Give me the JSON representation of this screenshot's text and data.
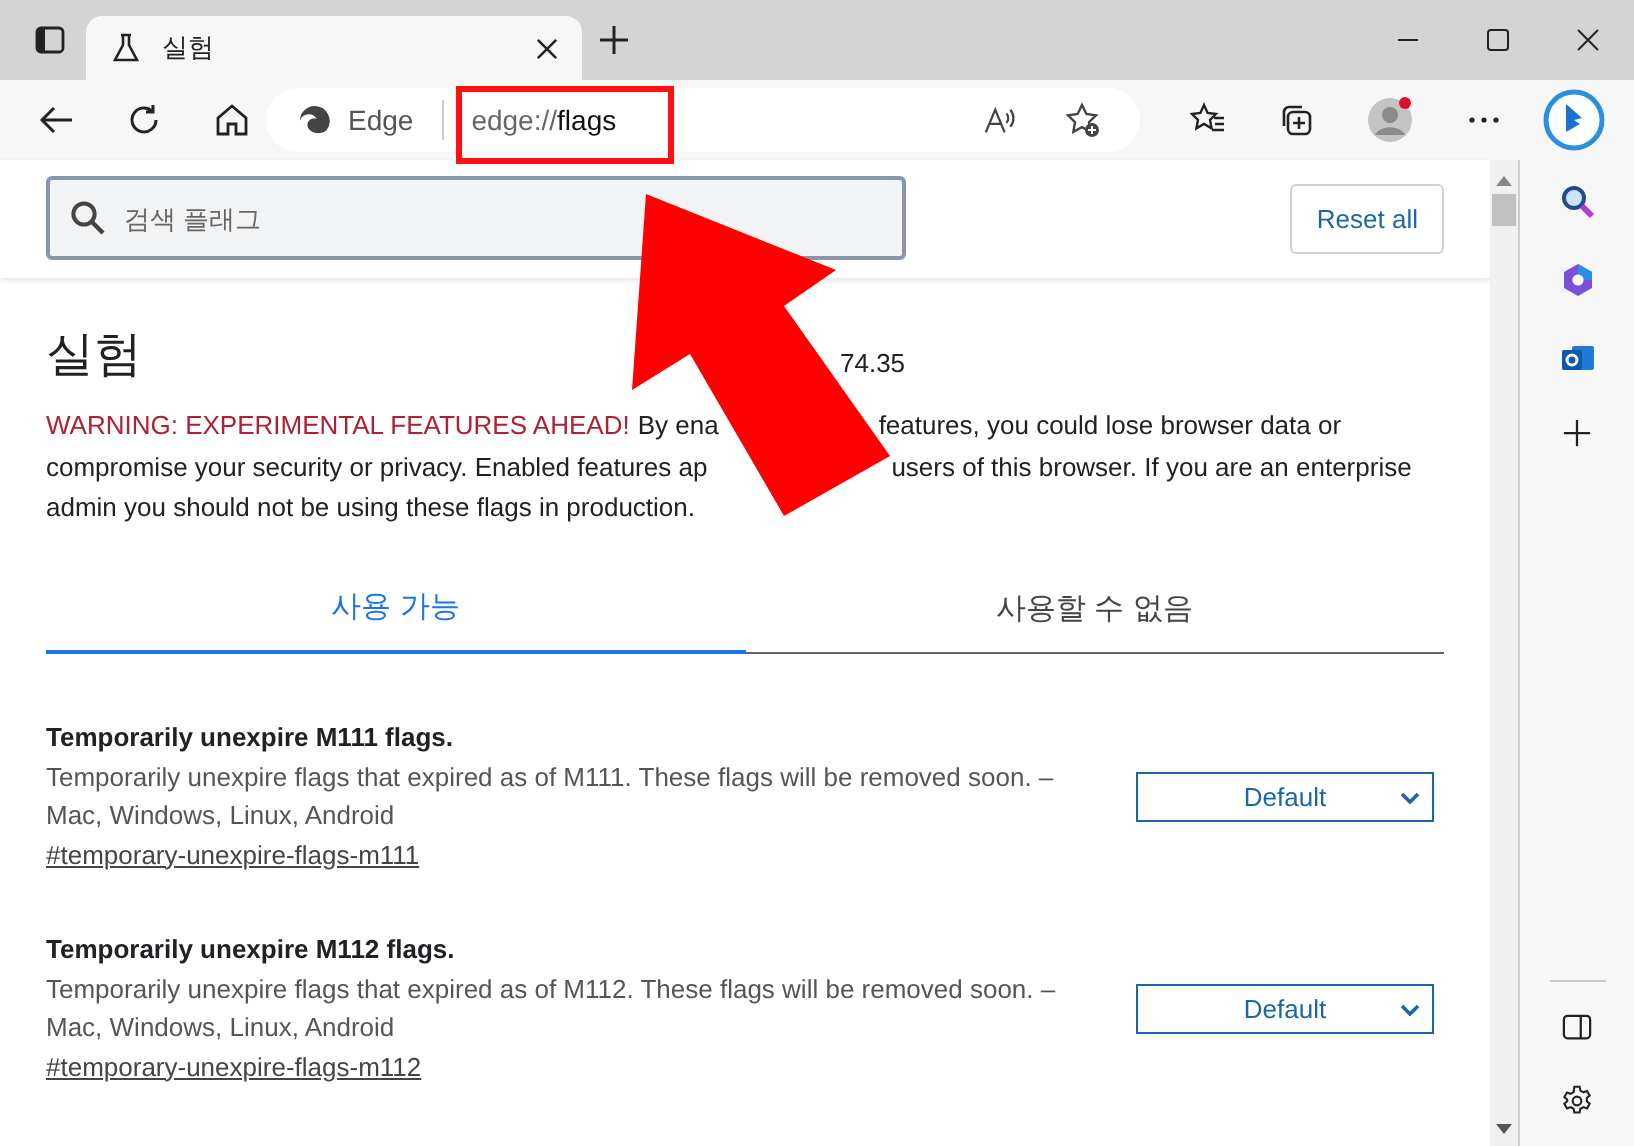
{
  "tab": {
    "title": "실험",
    "selected": true
  },
  "address_bar": {
    "site_label": "Edge",
    "url_scheme": "edge://",
    "url_path": "flags"
  },
  "search": {
    "placeholder": "검색 플래그"
  },
  "reset_button": "Reset all",
  "page_title": "실험",
  "version_fragment": "74.35",
  "warning_lines": [
    {
      "parts": [
        {
          "kind": "warning",
          "text": "WARNING: EXPERIMENTAL FEATURES AHEAD!"
        },
        {
          "kind": "plain",
          "text": "By ena"
        },
        {
          "kind": "gap"
        },
        {
          "kind": "plain",
          "text": "features, you could lose browser data or"
        }
      ]
    },
    {
      "parts": [
        {
          "kind": "plain",
          "text": "compromise your security or privacy. Enabled features ap"
        },
        {
          "kind": "gap"
        },
        {
          "kind": "plain",
          "text": "users of this browser. If you are an enterprise"
        }
      ]
    },
    {
      "parts": [
        {
          "kind": "plain",
          "text": "admin you should not be using these flags in production."
        }
      ]
    }
  ],
  "tabs": [
    {
      "label": "사용 가능",
      "selected": true
    },
    {
      "label": "사용할 수 없음",
      "selected": false
    }
  ],
  "flags": [
    {
      "title": "Temporarily unexpire M111 flags.",
      "description": "Temporarily unexpire flags that expired as of M111. These flags will be removed soon. –",
      "platforms": "Mac, Windows, Linux, Android",
      "link": "#temporary-unexpire-flags-m111",
      "value": "Default"
    },
    {
      "title": "Temporarily unexpire M112 flags.",
      "description": "Temporarily unexpire flags that expired as of M112. These flags will be removed soon. –",
      "platforms": "Mac, Windows, Linux, Android",
      "link": "#temporary-unexpire-flags-m112",
      "value": "Default"
    }
  ]
}
